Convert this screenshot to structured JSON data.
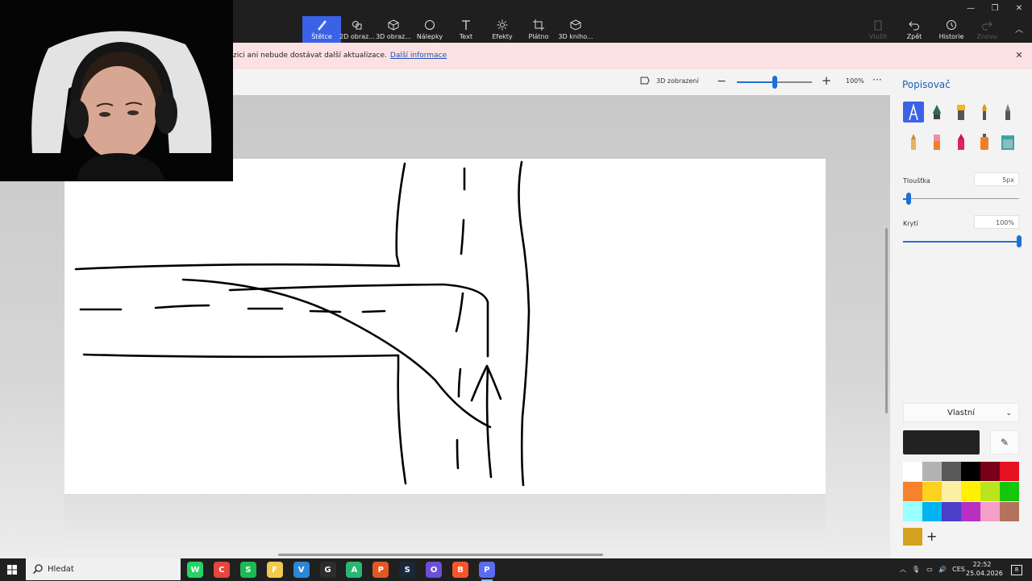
{
  "window": {
    "tools": [
      {
        "id": "brushes",
        "label": "Štětce",
        "active": true
      },
      {
        "id": "2d-shapes",
        "label": "2D obraz..."
      },
      {
        "id": "3d-shapes",
        "label": "3D obraz..."
      },
      {
        "id": "stickers",
        "label": "Nálepky"
      },
      {
        "id": "text",
        "label": "Text"
      },
      {
        "id": "effects",
        "label": "Efekty"
      },
      {
        "id": "canvas",
        "label": "Plátno"
      },
      {
        "id": "3d-library",
        "label": "3D kniho..."
      }
    ],
    "right_tools": [
      {
        "id": "paste",
        "label": "Vložit",
        "disabled": true
      },
      {
        "id": "undo",
        "label": "Zpět"
      },
      {
        "id": "history",
        "label": "Historie"
      },
      {
        "id": "redo",
        "label": "Znovu",
        "disabled": true
      }
    ]
  },
  "notice": {
    "text": "zici ani nebude dostávat další aktualizace.",
    "link": "Další informace"
  },
  "viewbar": {
    "view3d_label": "3D zobrazení",
    "zoom_percent": "100%",
    "zoom_level_fraction": 0.5
  },
  "panel": {
    "title": "Popisovač",
    "brushes": [
      "marker",
      "calligraphy-pen",
      "oil-brush",
      "watercolor",
      "pixel-pen",
      "pencil",
      "eraser",
      "crayon",
      "spray-can",
      "fill"
    ],
    "thickness_label": "Tloušťka",
    "thickness_value": "5px",
    "thickness_fraction": 0.05,
    "opacity_label": "Krytí",
    "opacity_value": "100%",
    "opacity_fraction": 1.0,
    "color_dropdown": "Vlastní",
    "current_color": "#222222",
    "palette": [
      "#ffffff",
      "#b3b3b3",
      "#595959",
      "#000000",
      "#7a0019",
      "#e81123",
      "#f7812e",
      "#fdd11e",
      "#fbeea5",
      "#fff100",
      "#b9e51e",
      "#16c60c",
      "#99ffff",
      "#00b4ef",
      "#4a3fc9",
      "#b82fc3",
      "#f59fc8",
      "#b4735a"
    ],
    "custom_color": "#d4a21e"
  },
  "taskbar": {
    "search_placeholder": "Hledat",
    "apps": [
      {
        "name": "whatsapp",
        "color": "#25d366",
        "glyph": "W"
      },
      {
        "name": "chrome",
        "color": "#e8453c",
        "glyph": "C"
      },
      {
        "name": "spotify",
        "color": "#1db954",
        "glyph": "S"
      },
      {
        "name": "file-explorer",
        "color": "#f2c94c",
        "glyph": "F"
      },
      {
        "name": "visual-studio",
        "color": "#2b88d8",
        "glyph": "V"
      },
      {
        "name": "github",
        "color": "#2d2d2d",
        "glyph": "G"
      },
      {
        "name": "app-green",
        "color": "#2bb673",
        "glyph": "A"
      },
      {
        "name": "app-colored",
        "color": "#e25822",
        "glyph": "P"
      },
      {
        "name": "steam",
        "color": "#1b2838",
        "glyph": "S"
      },
      {
        "name": "obs",
        "color": "#6b4fd8",
        "glyph": "O"
      },
      {
        "name": "brave",
        "color": "#fb542b",
        "glyph": "B"
      },
      {
        "name": "paint-3d",
        "color": "#5b6cf0",
        "glyph": "P",
        "active": true
      }
    ],
    "language": "CES",
    "time": "22:52",
    "date": "25.04.2026",
    "notifications": "8"
  }
}
